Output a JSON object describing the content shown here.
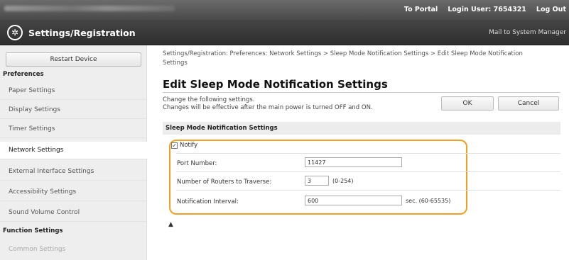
{
  "topbar": {
    "portal": "To Portal",
    "login_user": "Login User:",
    "login_user_id": "7654321",
    "logout": "Log Out"
  },
  "header": {
    "title": "Settings/Registration",
    "mail": "Mail to System Manager"
  },
  "sidebar": {
    "restart": "Restart Device",
    "section_preferences": "Preferences",
    "items": [
      {
        "label": "Paper Settings"
      },
      {
        "label": "Display Settings"
      },
      {
        "label": "Timer Settings"
      },
      {
        "label": "Network Settings"
      },
      {
        "label": "External Interface Settings"
      },
      {
        "label": "Accessibility Settings"
      },
      {
        "label": "Sound Volume Control"
      }
    ],
    "section_function": "Function Settings",
    "function_items": [
      {
        "label": "Common Settings"
      }
    ]
  },
  "main": {
    "breadcrumb": "Settings/Registration: Preferences: Network Settings > Sleep Mode Notification Settings > Edit Sleep Mode Notification Settings",
    "title": "Edit Sleep Mode Notification Settings",
    "desc_line1": "Change the following settings.",
    "desc_line2": "Changes will be effective after the main power is turned OFF and ON.",
    "ok": "OK",
    "cancel": "Cancel",
    "section_title": "Sleep Mode Notification Settings",
    "notify_label": "Notify",
    "notify_checked": true,
    "port_label": "Port Number:",
    "port_value": "11427",
    "routers_label": "Number of Routers to Traverse:",
    "routers_value": "3",
    "routers_range": "(0-254)",
    "interval_label": "Notification Interval:",
    "interval_value": "600",
    "interval_unit": "sec. (60-65535)",
    "top_link": "▲"
  },
  "colors": {
    "highlight": "#f0a020",
    "topbar": "#555555",
    "titlebar": "#3a3a3a"
  }
}
